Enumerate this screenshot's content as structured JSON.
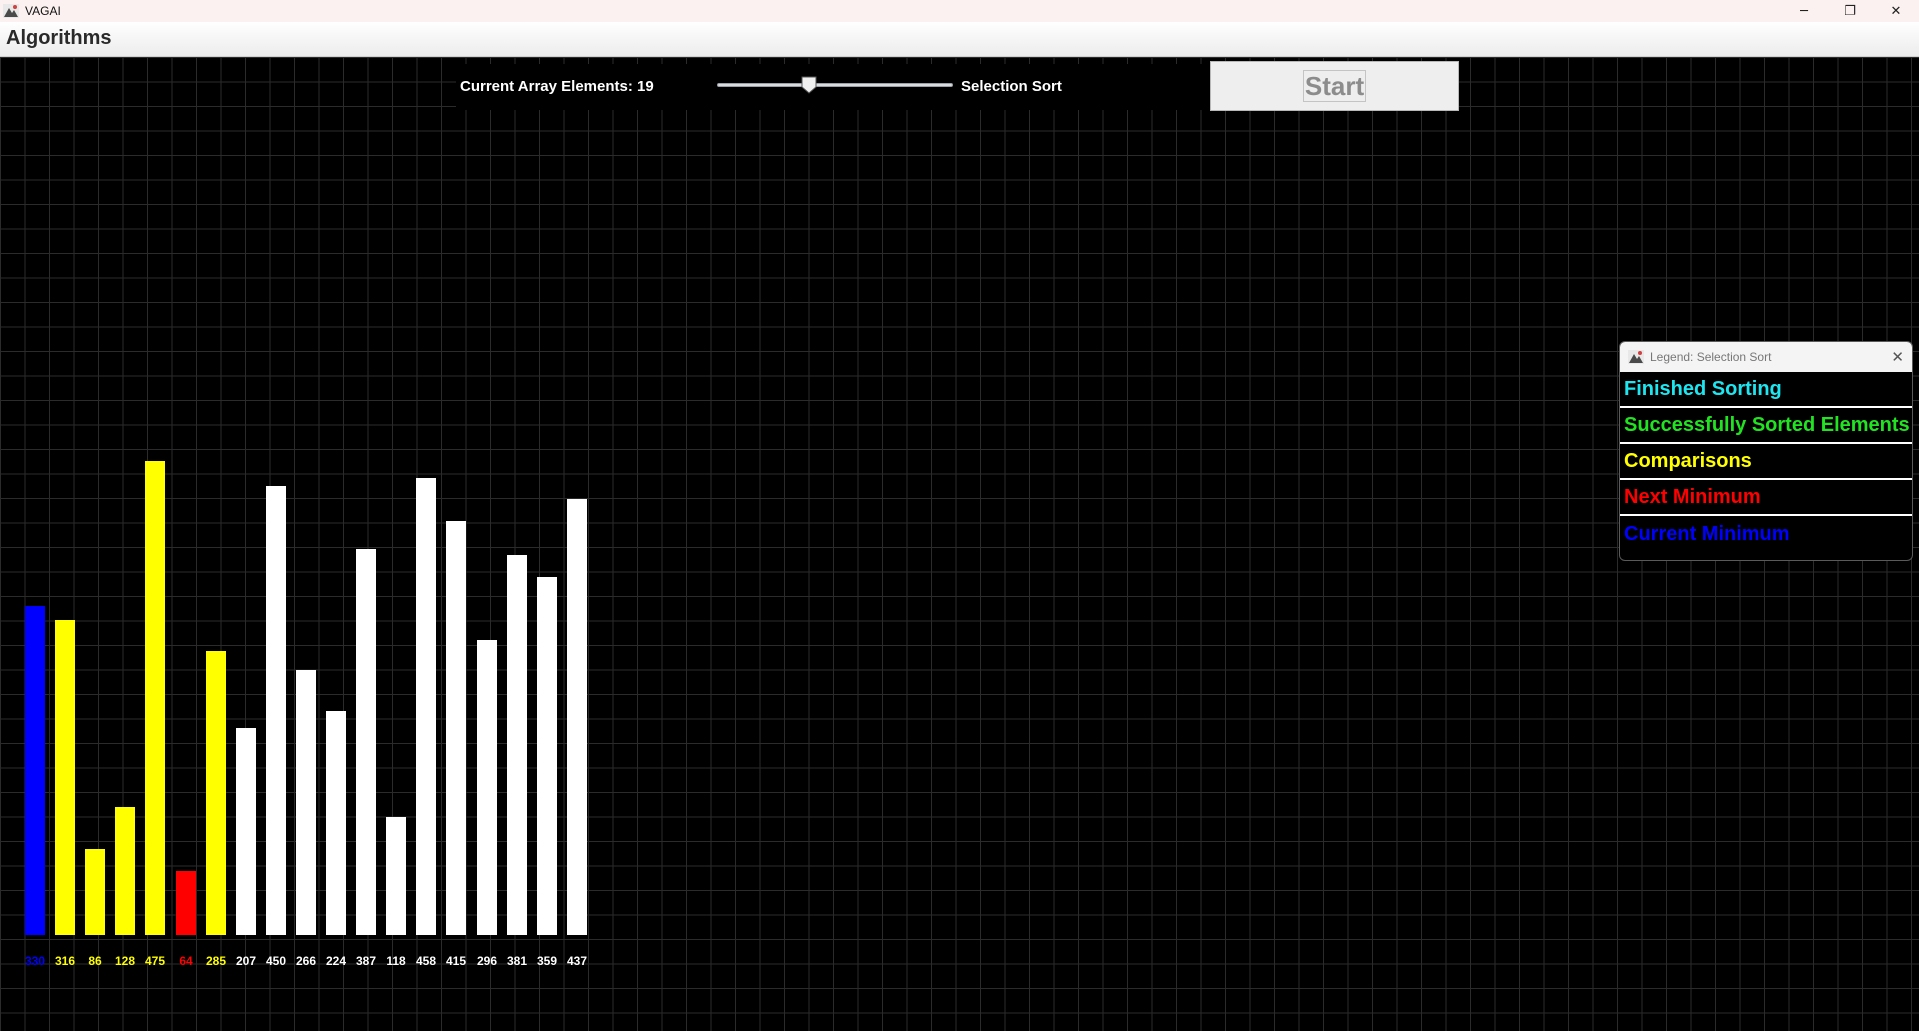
{
  "window": {
    "title": "VAGAI",
    "minimize_glyph": "─",
    "restore_glyph": "❐",
    "close_glyph": "✕"
  },
  "menu": {
    "items": [
      "Algorithms"
    ]
  },
  "controls": {
    "elements_label": "Current Array Elements: 19",
    "slider_value_fraction": 0.38,
    "algorithm_label": "Selection Sort",
    "start_label": "Start"
  },
  "array": {
    "values": [
      330,
      316,
      86,
      128,
      475,
      64,
      285,
      207,
      450,
      266,
      224,
      387,
      118,
      458,
      415,
      296,
      381,
      359,
      437
    ],
    "states": [
      "current-min",
      "comparison",
      "comparison",
      "comparison",
      "comparison",
      "next-min",
      "comparison",
      "default",
      "default",
      "default",
      "default",
      "default",
      "default",
      "default",
      "default",
      "default",
      "default",
      "default",
      "default"
    ]
  },
  "colors": {
    "current-min": "#0000ff",
    "comparison": "#ffff00",
    "next-min": "#ff0000",
    "default": "#ffffff",
    "finished": "#1de6f0",
    "sorted": "#22e322"
  },
  "legend": {
    "title": "Legend: Selection Sort",
    "close_glyph": "✕",
    "items": [
      {
        "label": "Finished Sorting",
        "color": "#1de6f0"
      },
      {
        "label": "Successfully Sorted Elements",
        "color": "#22e322"
      },
      {
        "label": "Comparisons",
        "color": "#ffff00"
      },
      {
        "label": "Next Minimum",
        "color": "#ff0000"
      },
      {
        "label": "Current Minimum",
        "color": "#0000ff"
      }
    ]
  }
}
